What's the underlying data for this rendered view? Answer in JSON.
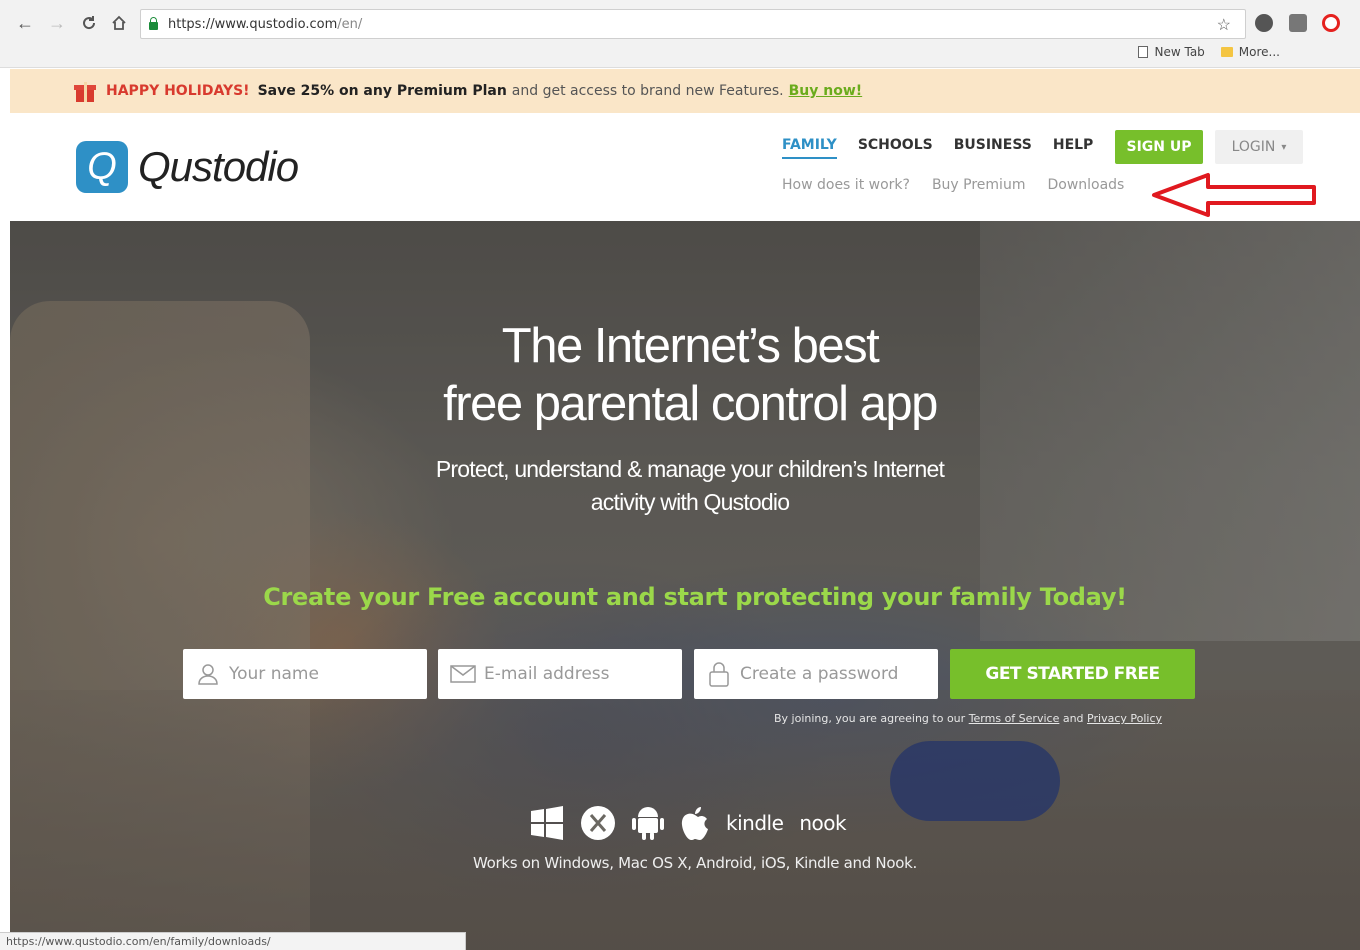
{
  "browser": {
    "url_main": "https://www.qustodio.com",
    "url_path": "/en/",
    "bookmarks": [
      "New Tab",
      "More..."
    ],
    "status_url": "https://www.qustodio.com/en/family/downloads/"
  },
  "promo": {
    "headline": "HAPPY HOLIDAYS!",
    "offer": "Save 25% on any Premium Plan",
    "text": "and get access to brand new Features.",
    "link": "Buy now!"
  },
  "header": {
    "logo_letter": "Q",
    "logo_text": "Qustodio",
    "nav": [
      "FAMILY",
      "SCHOOLS",
      "BUSINESS",
      "HELP"
    ],
    "subnav": [
      "How does it work?",
      "Buy Premium",
      "Downloads"
    ],
    "signup": "SIGN UP",
    "login": "LOGIN"
  },
  "hero": {
    "title_line1": "The Internet’s best",
    "title_line2": "free parental control app",
    "sub_line1": "Protect, understand & manage your children’s Internet",
    "sub_line2": "activity with Qustodio",
    "cta_heading": "Create your Free account and start protecting your family Today!",
    "name_placeholder": "Your name",
    "email_placeholder": "E-mail address",
    "password_placeholder": "Create a password",
    "get_started": "GET STARTED FREE",
    "terms_prefix": "By joining, you are agreeing to our",
    "terms_link": "Terms of Service",
    "terms_and": "and",
    "privacy_link": "Privacy Policy",
    "kindle": "kindle",
    "nook": "nook",
    "works_on": "Works on Windows, Mac OS X, Android, iOS, Kindle and Nook."
  },
  "colors": {
    "brand_blue": "#2e90c6",
    "brand_green": "#77bf2b",
    "cta_green": "#9bd84a",
    "promo_bg": "#fae6c8",
    "promo_red": "#d83a2e",
    "annotation_red": "#e0191f"
  }
}
